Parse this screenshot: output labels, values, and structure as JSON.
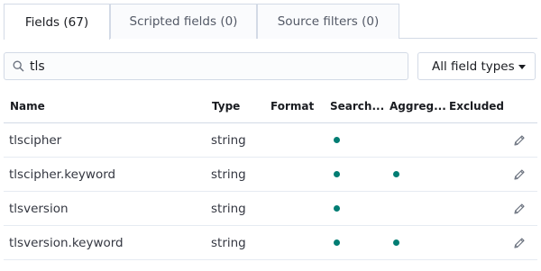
{
  "tabs": [
    {
      "label": "Fields (67)",
      "active": true
    },
    {
      "label": "Scripted fields (0)",
      "active": false
    },
    {
      "label": "Source filters (0)",
      "active": false
    }
  ],
  "search": {
    "value": "tls",
    "icon": "search-icon"
  },
  "type_filter": {
    "selected": "All field types",
    "icon": "caret-down-icon"
  },
  "table": {
    "columns": [
      "Name",
      "Type",
      "Format",
      "Search...",
      "Aggreg...",
      "Excluded"
    ],
    "rows": [
      {
        "name": "tlscipher",
        "type": "string",
        "searchable": true,
        "aggregatable": false
      },
      {
        "name": "tlscipher.keyword",
        "type": "string",
        "searchable": true,
        "aggregatable": true
      },
      {
        "name": "tlsversion",
        "type": "string",
        "searchable": true,
        "aggregatable": false
      },
      {
        "name": "tlsversion.keyword",
        "type": "string",
        "searchable": true,
        "aggregatable": true
      }
    ]
  },
  "colors": {
    "dot": "#017d73",
    "border": "#d3dae6"
  }
}
